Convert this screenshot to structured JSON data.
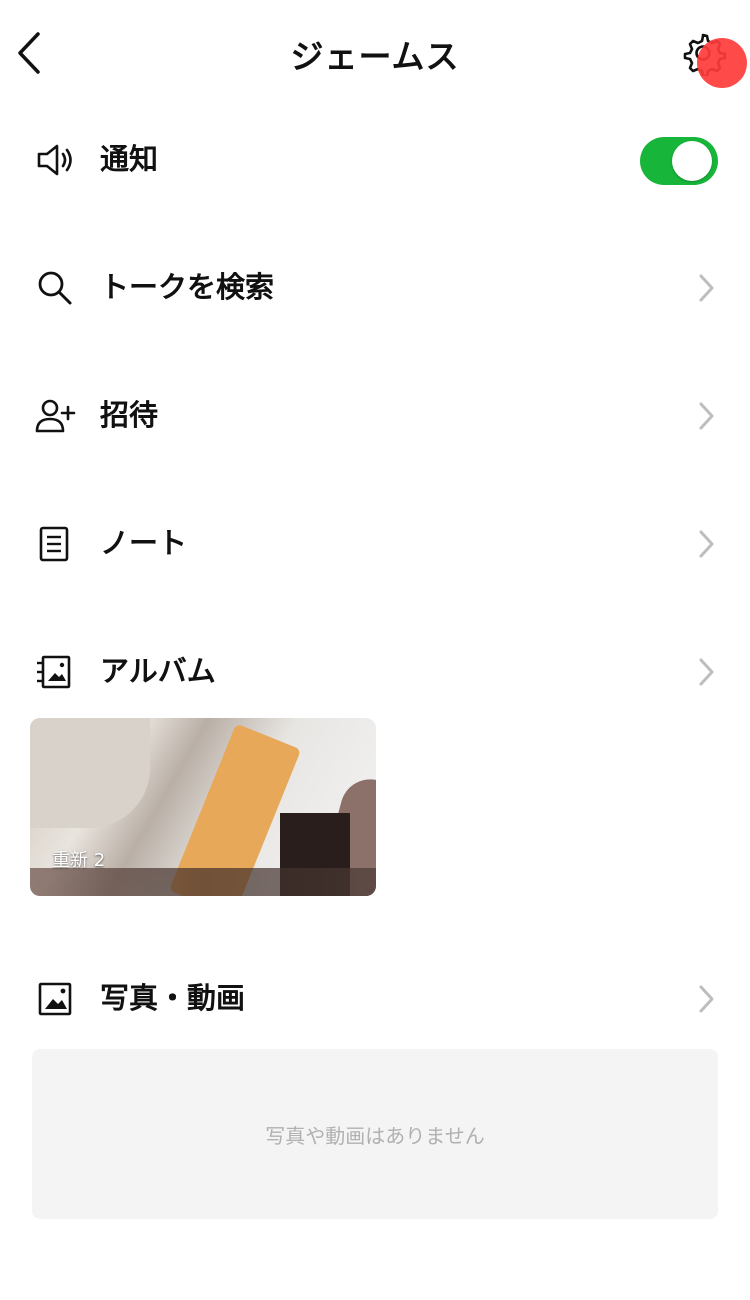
{
  "header": {
    "title": "ジェームス"
  },
  "rows": [
    {
      "label": "通知",
      "icon": "speaker-icon",
      "toggle_on": true
    },
    {
      "label": "トークを検索",
      "icon": "search-icon"
    },
    {
      "label": "招待",
      "icon": "add-user-icon"
    },
    {
      "label": "ノート",
      "icon": "note-icon"
    },
    {
      "label": "アルバム",
      "icon": "album-icon"
    },
    {
      "label": "写真・動画",
      "icon": "photo-icon"
    }
  ],
  "album": {
    "thumb_caption": "重新 2"
  },
  "photos": {
    "empty_text": "写真や動画はありません"
  },
  "colors": {
    "toggle_on": "#17b53a",
    "badge_red": "#ff3b3b"
  }
}
